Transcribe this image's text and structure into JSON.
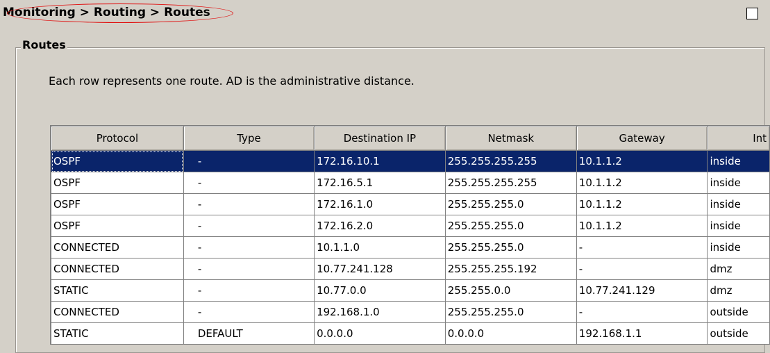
{
  "breadcrumb": "Monitoring > Routing > Routes",
  "groupbox_title": "Routes",
  "description": "Each row represents one route. AD is the administrative distance.",
  "table": {
    "headers": [
      "Protocol",
      "Type",
      "Destination IP",
      "Netmask",
      "Gateway",
      "Int"
    ],
    "rows": [
      [
        "OSPF",
        "-",
        "172.16.10.1",
        "255.255.255.255",
        "10.1.1.2",
        "inside"
      ],
      [
        "OSPF",
        "-",
        "172.16.5.1",
        "255.255.255.255",
        "10.1.1.2",
        "inside"
      ],
      [
        "OSPF",
        "-",
        "172.16.1.0",
        "255.255.255.0",
        "10.1.1.2",
        "inside"
      ],
      [
        "OSPF",
        "-",
        "172.16.2.0",
        "255.255.255.0",
        "10.1.1.2",
        "inside"
      ],
      [
        "CONNECTED",
        "-",
        "10.1.1.0",
        "255.255.255.0",
        " -",
        "inside"
      ],
      [
        "CONNECTED",
        "-",
        "10.77.241.128",
        "255.255.255.192",
        " -",
        "dmz"
      ],
      [
        "STATIC",
        "-",
        "10.77.0.0",
        "255.255.0.0",
        "10.77.241.129",
        "dmz"
      ],
      [
        "CONNECTED",
        "-",
        "192.168.1.0",
        "255.255.255.0",
        " -",
        "outside"
      ],
      [
        "STATIC",
        "DEFAULT",
        "0.0.0.0",
        "0.0.0.0",
        "192.168.1.1",
        "outside"
      ]
    ],
    "selected_row": 0
  },
  "colors": {
    "background": "#d4d0c8",
    "selection": "#0a246a",
    "annotation_oval": "#e01010"
  },
  "icons": {
    "maximize": "maximize-icon"
  }
}
